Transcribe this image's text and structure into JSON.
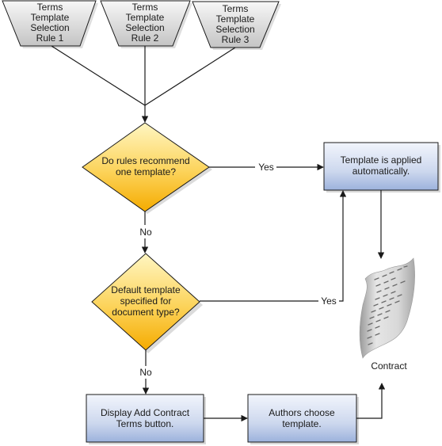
{
  "diagram": {
    "rules": [
      {
        "lines": [
          "Terms",
          "Template",
          "Selection",
          "Rule 1"
        ]
      },
      {
        "lines": [
          "Terms",
          "Template",
          "Selection",
          "Rule 2"
        ]
      },
      {
        "lines": [
          "Terms",
          "Template",
          "Selection",
          "Rule 3"
        ]
      }
    ],
    "decision1": {
      "lines": [
        "Do rules recommend",
        "one template?"
      ]
    },
    "decision2": {
      "lines": [
        "Default template",
        "specified for",
        "document type?"
      ]
    },
    "auto_box": {
      "lines": [
        "Template is applied",
        "automatically."
      ]
    },
    "display_box": {
      "lines": [
        "Display Add Contract",
        "Terms button."
      ]
    },
    "authors_box": {
      "lines": [
        "Authors choose",
        "template."
      ]
    },
    "contract_label": "Contract",
    "edge_labels": {
      "yes1": "Yes",
      "yes2": "Yes",
      "no1": "No",
      "no2": "No"
    },
    "colors": {
      "decision_fill_top": "#fff3b0",
      "decision_fill_bottom": "#f7b500",
      "process_fill_top": "#eef2fb",
      "process_fill_bottom": "#9fb4dc",
      "rule_fill_top": "#f4f4f4",
      "rule_fill_bottom": "#c8c8c8"
    }
  }
}
